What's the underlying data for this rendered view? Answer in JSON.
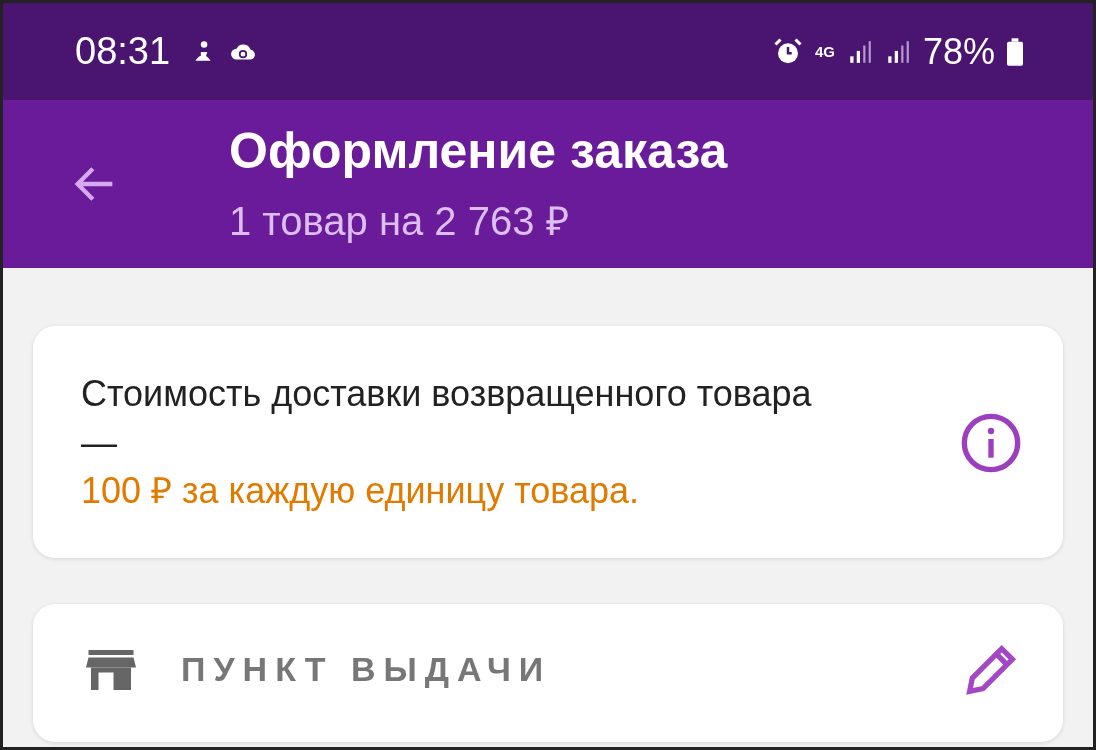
{
  "status_bar": {
    "time": "08:31",
    "network": "4G",
    "battery": "78%"
  },
  "app_bar": {
    "title": "Оформление заказа",
    "subtitle": "1 товар на 2 763 ₽"
  },
  "notice": {
    "text": "Стоимость доставки возвращенного товара —",
    "highlight": "100 ₽ за каждую единицу товара."
  },
  "pickup_section": {
    "title": "ПУНКТ ВЫДАЧИ"
  }
}
